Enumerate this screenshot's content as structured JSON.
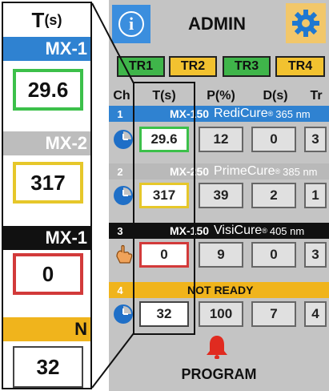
{
  "zoom": {
    "header_t": "T",
    "header_unit": "(s)",
    "bands": [
      "MX-1",
      "MX-2",
      "MX-1",
      "N"
    ],
    "values": [
      "29.6",
      "317",
      "0",
      "32"
    ]
  },
  "header": {
    "info_label": "i",
    "title": "ADMIN"
  },
  "tr_tabs": [
    "TR1",
    "TR2",
    "TR3",
    "TR4"
  ],
  "columns": {
    "ch": "Ch",
    "t": "T(s)",
    "p": "P(%)",
    "d": "D(s)",
    "tr": "Tr"
  },
  "channels": [
    {
      "num": "1",
      "mx": "MX-150",
      "product": "RediCure",
      "reg": "®",
      "nm": "365 nm",
      "t": "29.6",
      "p": "12",
      "d": "0",
      "tr": "3",
      "band_color": "#2f82d1",
      "t_border": "#3cc04a",
      "icon": "clock-icon"
    },
    {
      "num": "2",
      "mx": "MX-250",
      "product": "PrimeCure",
      "reg": "®",
      "nm": "385 nm",
      "t": "317",
      "p": "39",
      "d": "2",
      "tr": "1",
      "band_color": "#b9b9b9",
      "t_border": "#e6c72a",
      "icon": "clock-icon"
    },
    {
      "num": "3",
      "mx": "MX-150",
      "product": "VisiCure",
      "reg": "®",
      "nm": "405 nm",
      "t": "0",
      "p": "9",
      "d": "0",
      "tr": "3",
      "band_color": "#111111",
      "t_border": "#d23a3a",
      "icon": "hand-icon"
    },
    {
      "num": "4",
      "mx": "",
      "product": "NOT  READY",
      "reg": "",
      "nm": "",
      "t": "32",
      "p": "100",
      "d": "7",
      "tr": "4",
      "band_color": "#f0b41c",
      "t_border": "#444444",
      "icon": "clock-icon"
    }
  ],
  "program_label": "PROGRAM",
  "colors": {
    "blue": "#2f82d1",
    "green": "#3cc04a",
    "yellow": "#e6c72a",
    "red": "#d23a3a",
    "amber": "#f0b41c",
    "tr_green": "#3fb54a",
    "tr_yellow": "#f2c230"
  }
}
